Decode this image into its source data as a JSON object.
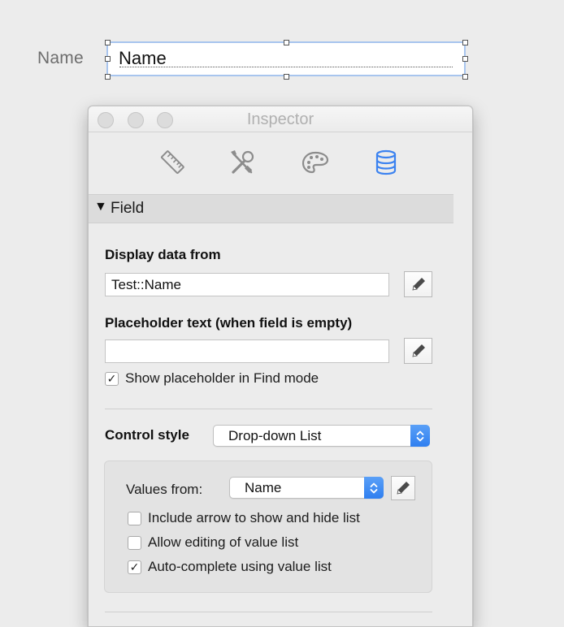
{
  "layout": {
    "field_label": "Name",
    "field_value": "Name"
  },
  "inspector": {
    "title": "Inspector",
    "tabs": [
      {
        "name": "position",
        "icon": "ruler-icon",
        "active": false
      },
      {
        "name": "styles",
        "icon": "tools-icon",
        "active": false
      },
      {
        "name": "appearance",
        "icon": "palette-icon",
        "active": false
      },
      {
        "name": "data",
        "icon": "database-icon",
        "active": true
      }
    ],
    "section": {
      "triangle": "▼",
      "title": "Field"
    },
    "display_data": {
      "label": "Display data from",
      "value": "Test::Name"
    },
    "placeholder": {
      "label": "Placeholder text (when field is empty)",
      "value": "",
      "show_in_find_label": "Show placeholder in Find mode",
      "show_in_find_checked": true
    },
    "control_style": {
      "label": "Control style",
      "value": "Drop-down List"
    },
    "values": {
      "label": "Values from:",
      "value": "Name",
      "options": [
        {
          "label": "Include arrow to show and hide list",
          "checked": false
        },
        {
          "label": "Allow editing of value list",
          "checked": false
        },
        {
          "label": "Auto-complete using value list",
          "checked": true
        }
      ]
    }
  },
  "colors": {
    "accent": "#2f7ff0",
    "active_icon": "#3b82f0",
    "inactive_icon": "#8c8c8c",
    "selection_border": "#a8c5ee"
  }
}
